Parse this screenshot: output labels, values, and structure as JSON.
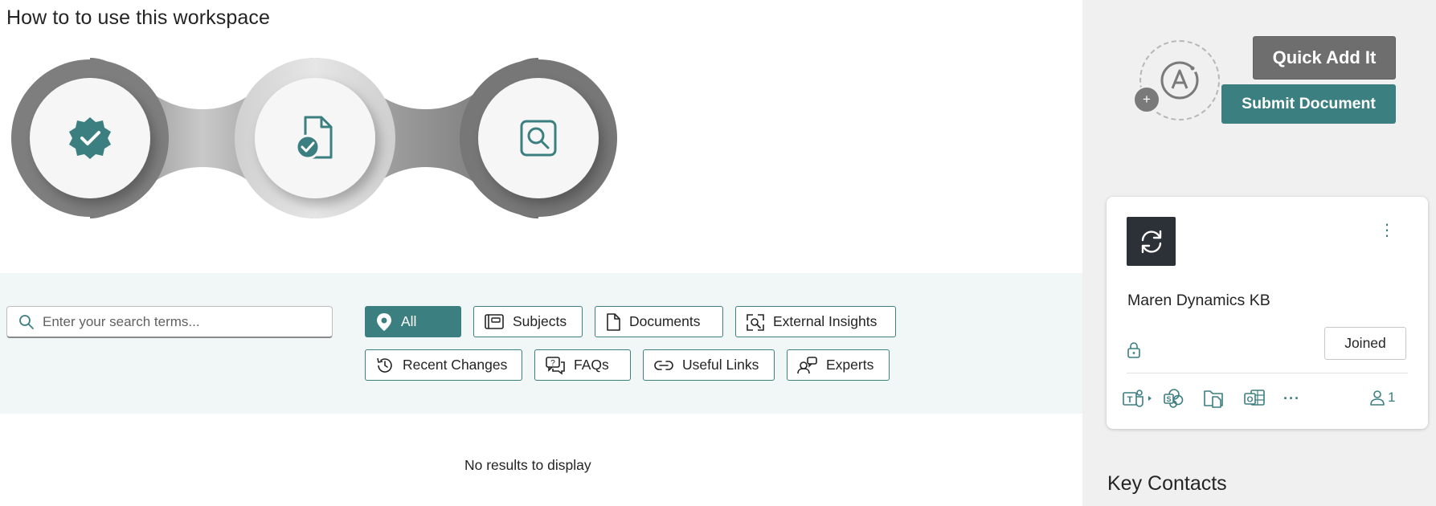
{
  "page": {
    "title": "How to to use this workspace"
  },
  "steps": [
    {
      "icon": "verified-badge-icon"
    },
    {
      "icon": "document-checkmark-icon"
    },
    {
      "icon": "search-square-icon"
    }
  ],
  "search": {
    "placeholder": "Enter your search terms...",
    "value": ""
  },
  "filters": [
    {
      "label": "All",
      "icon": "location-pin-icon",
      "active": true
    },
    {
      "label": "Subjects",
      "icon": "subjects-icon",
      "active": false
    },
    {
      "label": "Documents",
      "icon": "document-icon",
      "active": false
    },
    {
      "label": "External Insights",
      "icon": "external-insights-icon",
      "active": false
    },
    {
      "label": "Recent Changes",
      "icon": "history-icon",
      "active": false
    },
    {
      "label": "FAQs",
      "icon": "faq-icon",
      "active": false
    },
    {
      "label": "Useful Links",
      "icon": "link-icon",
      "active": false
    },
    {
      "label": "Experts",
      "icon": "experts-icon",
      "active": false
    }
  ],
  "results": {
    "empty_message": "No results to display"
  },
  "side": {
    "avatar_plus": "+",
    "quick_add_label": "Quick Add It",
    "submit_label": "Submit Document",
    "card": {
      "more_glyph": "⋮",
      "title": "Maren Dynamics KB",
      "joined_label": "Joined",
      "apps": [
        "teams-icon",
        "sharepoint-icon",
        "files-icon",
        "outlook-icon",
        "more-horizontal-icon"
      ],
      "more_apps": "···",
      "member_count": "1"
    },
    "key_contacts_title": "Key Contacts"
  },
  "colors": {
    "accent": "#3b7f80",
    "quick_add_bg": "#6e6e6e",
    "side_bg": "#f0f0f0",
    "band_bg": "#f1f7f7"
  }
}
